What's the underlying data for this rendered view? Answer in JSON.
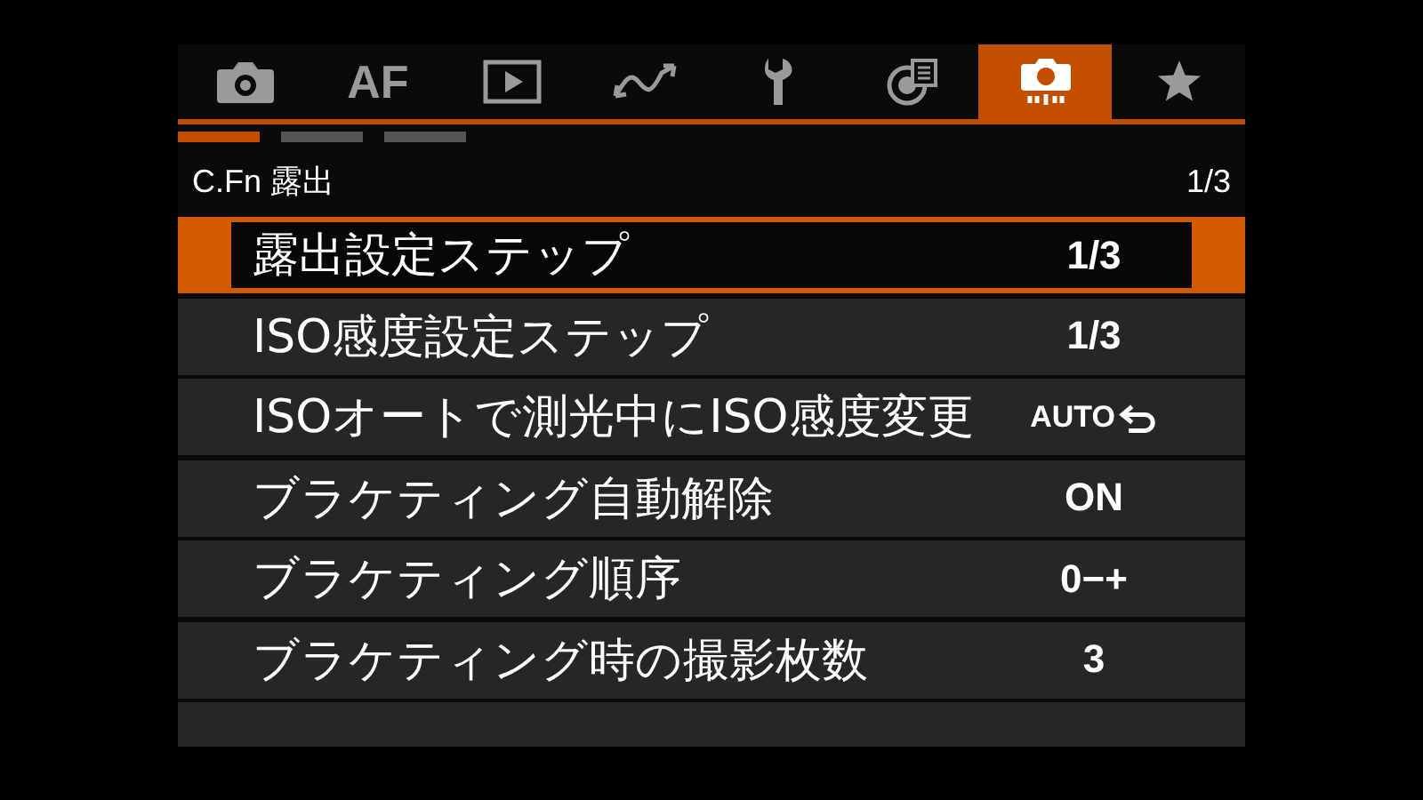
{
  "tabs": [
    {
      "kind": "camera",
      "selected": false
    },
    {
      "kind": "text",
      "label": "AF",
      "selected": false
    },
    {
      "kind": "play",
      "selected": false
    },
    {
      "kind": "wave",
      "selected": false
    },
    {
      "kind": "wrench",
      "selected": false
    },
    {
      "kind": "network",
      "selected": false
    },
    {
      "kind": "custom-camera",
      "selected": true
    },
    {
      "kind": "star",
      "selected": false
    }
  ],
  "pages": [
    {
      "selected": true
    },
    {
      "selected": false
    },
    {
      "selected": false
    }
  ],
  "header": {
    "title": "C.Fn 露出",
    "page": "1/3"
  },
  "rows": [
    {
      "label": "露出設定ステップ",
      "value": "1/3",
      "kind": "text",
      "selected": true
    },
    {
      "label": "ISO感度設定ステップ",
      "value": "1/3",
      "kind": "text",
      "selected": false
    },
    {
      "label": "ISOオートで測光中にISO感度変更",
      "value": "AUTO",
      "kind": "return",
      "selected": false
    },
    {
      "label": "ブラケティング自動解除",
      "value": "ON",
      "kind": "text",
      "selected": false
    },
    {
      "label": "ブラケティング順序",
      "value": "0−+",
      "kind": "text",
      "selected": false
    },
    {
      "label": "ブラケティング時の撮影枚数",
      "value": "3",
      "kind": "text",
      "selected": false
    }
  ]
}
